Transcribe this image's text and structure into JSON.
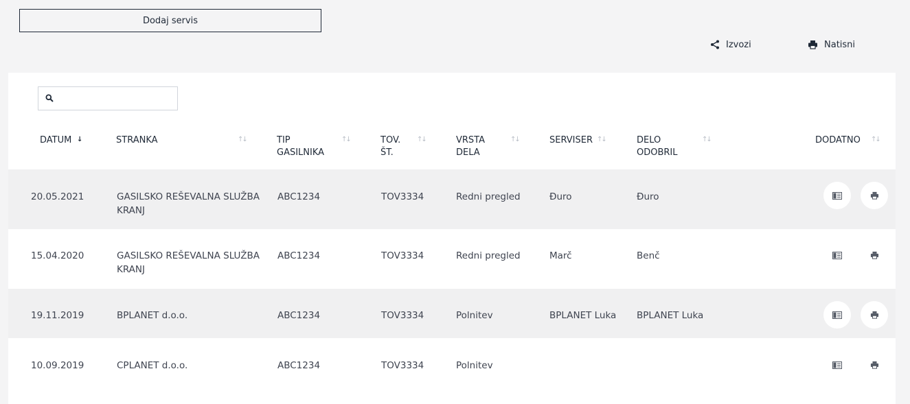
{
  "toolbar": {
    "add_label": "Dodaj servis",
    "export_label": "Izvozi",
    "print_label": "Natisni"
  },
  "search": {
    "placeholder": "",
    "value": ""
  },
  "columns": [
    {
      "label": "DATUM",
      "sort": "desc"
    },
    {
      "label": "STRANKA",
      "sort": "none"
    },
    {
      "label": "TIP\nGASILNIKA",
      "sort": "none"
    },
    {
      "label": "TOV.\nŠT.",
      "sort": "none"
    },
    {
      "label": "VRSTA\nDELA",
      "sort": "none"
    },
    {
      "label": "SERVISER",
      "sort": "none"
    },
    {
      "label": "DELO\nODOBRIL",
      "sort": "none"
    },
    {
      "label": "DODATNO",
      "sort": "none"
    }
  ],
  "rows": [
    {
      "datum": "20.05.2021",
      "stranka": "GASILSKO REŠEVALNA SLUŽBA KRANJ",
      "tip": "ABC1234",
      "tov": "TOV3334",
      "vrsta": "Redni pregled",
      "serviser": "Đuro",
      "odobril": "Đuro"
    },
    {
      "datum": "15.04.2020",
      "stranka": "GASILSKO REŠEVALNA SLUŽBA KRANJ",
      "tip": "ABC1234",
      "tov": "TOV3334",
      "vrsta": "Redni pregled",
      "serviser": "Marč",
      "odobril": "Benč"
    },
    {
      "datum": "19.11.2019",
      "stranka": "BPLANET d.o.o.",
      "tip": "ABC1234",
      "tov": "TOV3334",
      "vrsta": "Polnitev",
      "serviser": "BPLANET Luka",
      "odobril": "BPLANET Luka"
    },
    {
      "datum": "10.09.2019",
      "stranka": "CPLANET d.o.o.",
      "tip": "ABC1234",
      "tov": "TOV3334",
      "vrsta": "Polnitev",
      "serviser": "",
      "odobril": ""
    }
  ],
  "icons": {
    "export": "share-icon",
    "print": "printer-icon",
    "search": "search-icon",
    "details": "document-icon",
    "sort": "sort-icon"
  },
  "colors": {
    "background": "#f4f4f5",
    "panel": "#ffffff",
    "row_shaded": "#f0f0f1",
    "text": "#1f2937"
  }
}
